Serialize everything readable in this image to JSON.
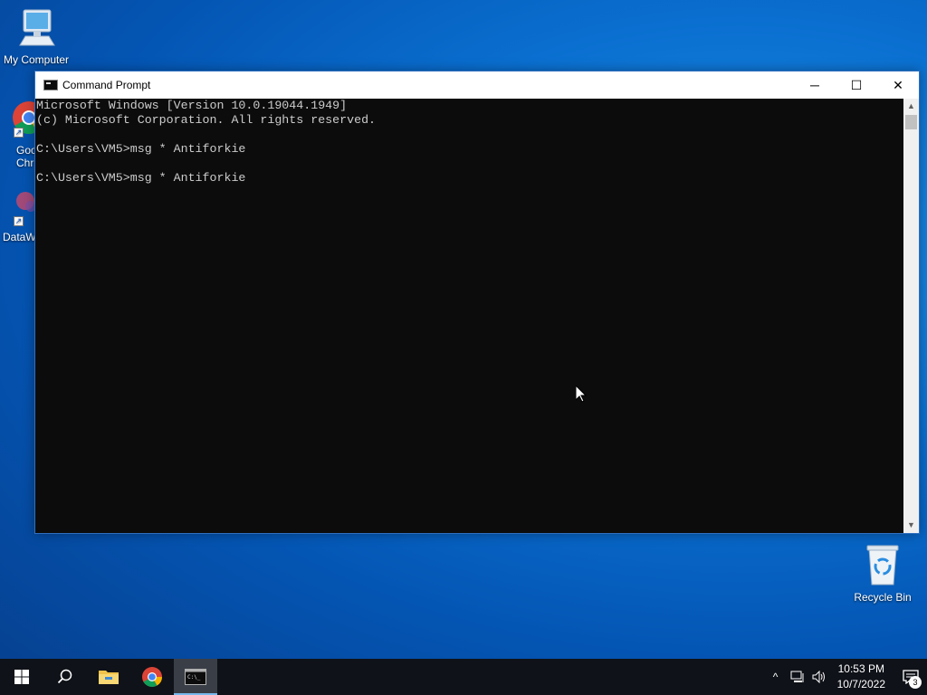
{
  "desktop": {
    "icons": [
      {
        "label": "My Computer"
      },
      {
        "label": "Goo\nChr"
      },
      {
        "label": "DataW"
      },
      {
        "label": "Recycle Bin"
      }
    ]
  },
  "window": {
    "title": "Command Prompt",
    "controls": {
      "minimize": "─",
      "maximize": "☐",
      "close": "✕"
    },
    "console_lines": [
      "Microsoft Windows [Version 10.0.19044.1949]",
      "(c) Microsoft Corporation. All rights reserved.",
      "",
      "C:\\Users\\VM5>msg * Antiforkie",
      "",
      "C:\\Users\\VM5>msg * Antiforkie"
    ],
    "colors": {
      "console_bg": "#0c0c0c",
      "console_text": "#cccccc"
    }
  },
  "taskbar": {
    "buttons": [
      {
        "name": "start-button",
        "icon": "windows-logo-icon"
      },
      {
        "name": "search-button",
        "icon": "search-icon"
      },
      {
        "name": "file-explorer-button",
        "icon": "folder-icon"
      },
      {
        "name": "chrome-button",
        "icon": "chrome-icon"
      },
      {
        "name": "command-prompt-button",
        "icon": "cmd-icon",
        "active": true
      }
    ],
    "tray": {
      "chevron": "^",
      "time": "10:53 PM",
      "date": "10/7/2022",
      "notification_count": "3"
    }
  }
}
